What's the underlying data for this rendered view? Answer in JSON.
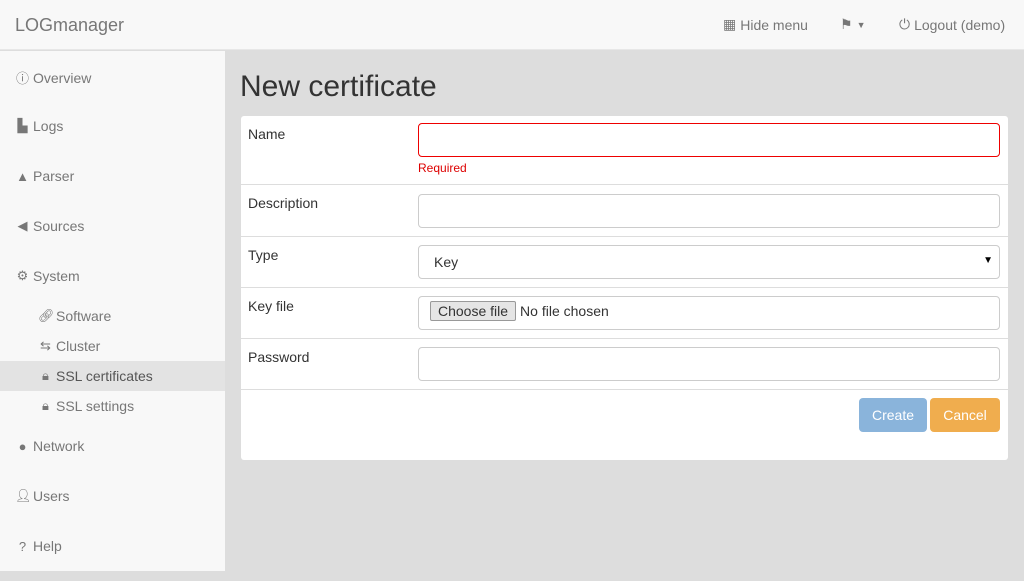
{
  "nav": {
    "brand": "LOGmanager",
    "hide_menu": "Hide menu",
    "logout": "Logout (demo)"
  },
  "sidebar": {
    "items": [
      {
        "label": "Overview",
        "icon": "info-icon"
      },
      {
        "label": "Logs",
        "icon": "file-icon"
      },
      {
        "label": "Parser",
        "icon": "road-icon"
      },
      {
        "label": "Sources",
        "icon": "bullhorn-icon"
      },
      {
        "label": "System",
        "icon": "gear-icon"
      },
      {
        "label": "Network",
        "icon": "globe-icon"
      },
      {
        "label": "Users",
        "icon": "user-icon"
      },
      {
        "label": "Help",
        "icon": "question-icon"
      }
    ],
    "sub": [
      {
        "label": "Software",
        "icon": "link-icon"
      },
      {
        "label": "Cluster",
        "icon": "retweet-icon"
      },
      {
        "label": "SSL certificates",
        "icon": "lock-icon",
        "active": true
      },
      {
        "label": "SSL settings",
        "icon": "lock-icon"
      }
    ]
  },
  "page": {
    "title": "New certificate"
  },
  "form": {
    "name_label": "Name",
    "name_value": "",
    "required": "Required",
    "description_label": "Description",
    "type_label": "Type",
    "type_value": "Key",
    "keyfile_label": "Key file",
    "choose_file": "Choose file",
    "no_file": "No file chosen",
    "password_label": "Password",
    "create": "Create",
    "cancel": "Cancel"
  },
  "colors": {
    "create": "#8ab4db",
    "cancel": "#f0ad4e",
    "error": "#dd0000"
  }
}
